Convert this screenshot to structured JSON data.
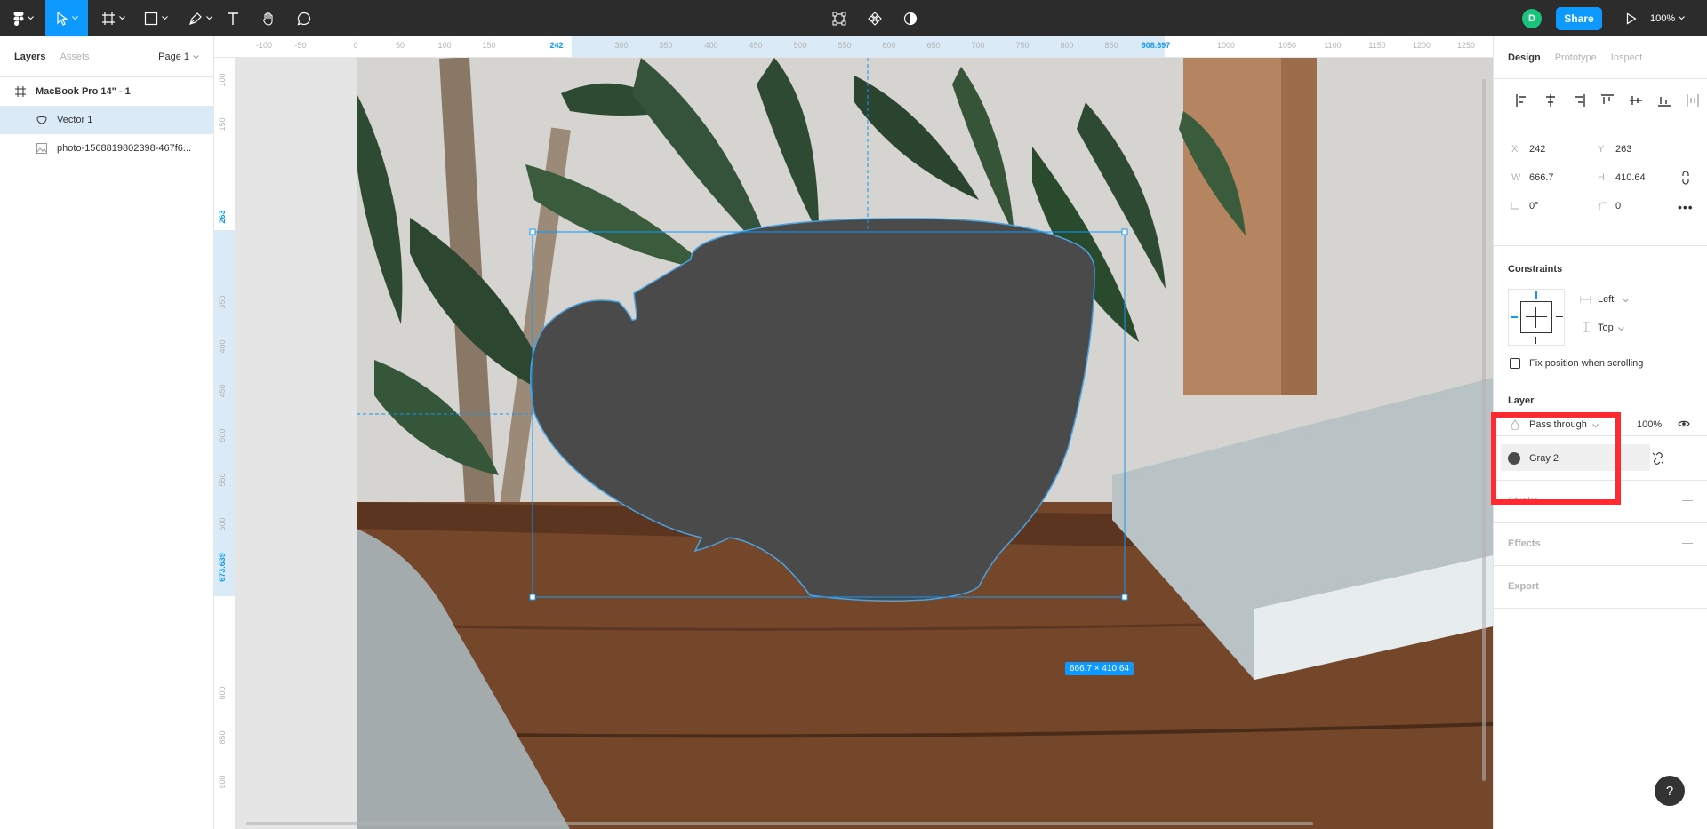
{
  "toolbar": {
    "zoom": "100%",
    "share_label": "Share",
    "avatar_initial": "D"
  },
  "left_panel": {
    "tabs": [
      "Layers",
      "Assets"
    ],
    "page": "Page 1",
    "layers": [
      {
        "name": "MacBook Pro 14\" - 1",
        "icon": "frame-icon"
      },
      {
        "name": "Vector 1",
        "icon": "vector-icon"
      },
      {
        "name": "photo-1568819802398-467f6...",
        "icon": "image-icon"
      }
    ]
  },
  "ruler": {
    "top_ticks": [
      "-100",
      "-50",
      "0",
      "50",
      "100",
      "150",
      "242",
      "300",
      "350",
      "400",
      "450",
      "500",
      "550",
      "600",
      "650",
      "700",
      "750",
      "800",
      "850",
      "908.697",
      "1000",
      "1050",
      "1100",
      "1150",
      "1200",
      "1250"
    ],
    "left_ticks": [
      "100",
      "150",
      "263",
      "350",
      "400",
      "450",
      "500",
      "550",
      "600",
      "673.639",
      "800",
      "850",
      "900"
    ]
  },
  "canvas": {
    "selection_size": "666.7 × 410.64"
  },
  "right_panel": {
    "tabs": [
      "Design",
      "Prototype",
      "Inspect"
    ],
    "x_label": "X",
    "x": "242",
    "y_label": "Y",
    "y": "263",
    "w_label": "W",
    "w": "666.7",
    "h_label": "H",
    "h": "410.64",
    "rotation": "0°",
    "radius": "0",
    "constraints_title": "Constraints",
    "constraint_h": "Left",
    "constraint_v": "Top",
    "fix_position_label": "Fix position when scrolling",
    "layer_title": "Layer",
    "blend_mode": "Pass through",
    "opacity": "100%",
    "fill_style": "Gray 2",
    "fill_color": "#4a4a4a",
    "stroke_title": "Stroke",
    "effects_title": "Effects",
    "export_title": "Export"
  },
  "colors": {
    "accent": "#0d99ff",
    "highlight": "#ff2b30"
  }
}
